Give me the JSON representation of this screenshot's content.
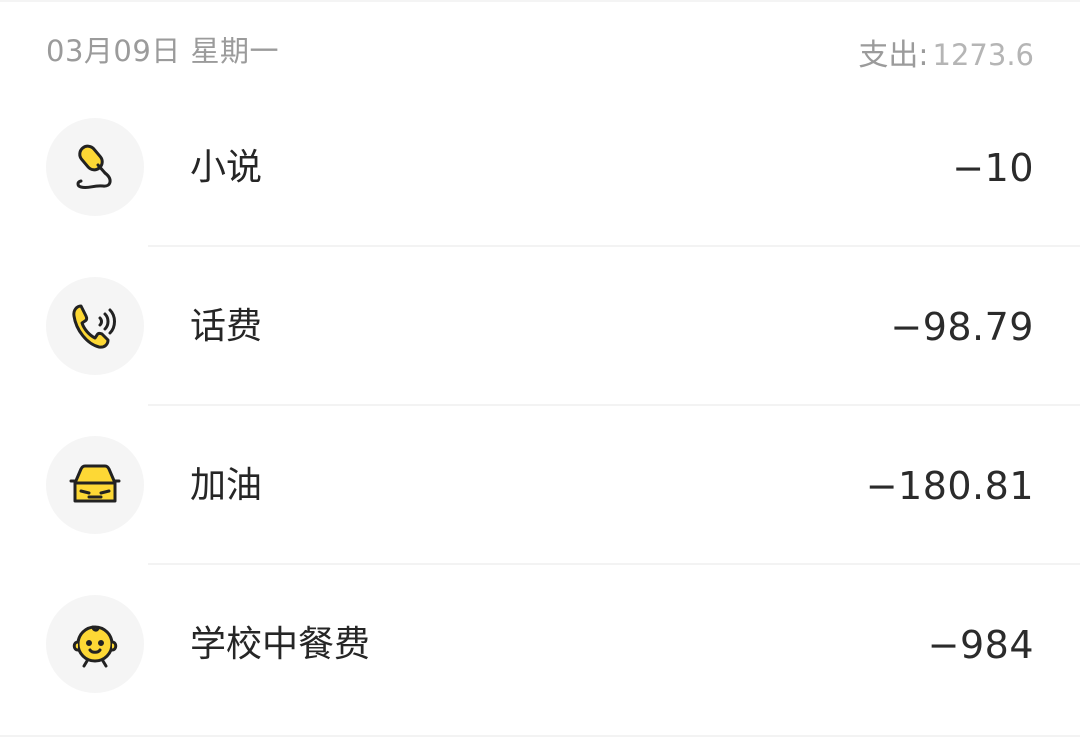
{
  "day": {
    "date": "03月09日",
    "weekday": "星期一",
    "total_label": "支出:",
    "total_value": "1273.6"
  },
  "transactions": [
    {
      "icon": "microphone-icon",
      "label": "小说",
      "amount": "−10"
    },
    {
      "icon": "phone-icon",
      "label": "话费",
      "amount": "−98.79"
    },
    {
      "icon": "car-icon",
      "label": "加油",
      "amount": "−180.81"
    },
    {
      "icon": "baby-face-icon",
      "label": "学校中餐费",
      "amount": "−984"
    }
  ],
  "colors": {
    "icon_fill": "#fdd835",
    "icon_stroke": "#222222",
    "icon_bg": "#f5f5f5",
    "muted_text": "#9b9b9b"
  }
}
